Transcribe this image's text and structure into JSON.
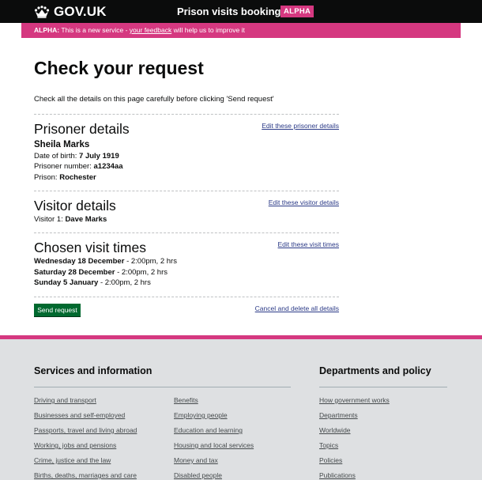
{
  "header": {
    "logo_text": "GOV.UK",
    "service_name": "Prison visits booking",
    "phase_tag": "ALPHA"
  },
  "phase_banner": {
    "label": "ALPHA:",
    "text_before": "This is a new service -",
    "link_text": "your feedback",
    "text_after": "will help us to improve it"
  },
  "page": {
    "title": "Check your request",
    "intro": "Check all the details on this page carefully before clicking 'Send request'"
  },
  "prisoner": {
    "heading": "Prisoner details",
    "edit_link": "Edit these prisoner details",
    "name": "Sheila Marks",
    "dob_label": "Date of birth:",
    "dob_value": "7 July 1919",
    "number_label": "Prisoner number:",
    "number_value": "a1234aa",
    "prison_label": "Prison:",
    "prison_value": "Rochester"
  },
  "visitor": {
    "heading": "Visitor details",
    "edit_link": "Edit these visitor details",
    "visitor1_label": "Visitor 1:",
    "visitor1_value": "Dave Marks"
  },
  "visits": {
    "heading": "Chosen visit times",
    "edit_link": "Edit these visit times",
    "times": [
      {
        "date": "Wednesday 18 December",
        "detail": "- 2:00pm, 2 hrs"
      },
      {
        "date": "Saturday 28 December",
        "detail": "- 2:00pm, 2 hrs"
      },
      {
        "date": "Sunday 5 January",
        "detail": "- 2:00pm, 2 hrs"
      }
    ]
  },
  "actions": {
    "send_button": "Send request",
    "cancel_link": "Cancel and delete all details"
  },
  "footer": {
    "services_heading": "Services and information",
    "services_col1": [
      "Driving and transport",
      "Businesses and self-employed",
      "Passports, travel and living abroad",
      "Working, jobs and pensions",
      "Crime, justice and the law",
      "Births, deaths, marriages and care"
    ],
    "services_col2": [
      "Benefits",
      "Employing people",
      "Education and learning",
      "Housing and local services",
      "Money and tax",
      "Disabled people"
    ],
    "departments_heading": "Departments and policy",
    "departments": [
      "How government works",
      "Departments",
      "Worldwide",
      "Topics",
      "Policies",
      "Publications"
    ]
  },
  "colors": {
    "header_bg": "#0b0c0c",
    "accent_pink": "#d53880",
    "button_green": "#00692f",
    "link_blue": "#2b3a87",
    "footer_bg": "#dee0e2"
  }
}
